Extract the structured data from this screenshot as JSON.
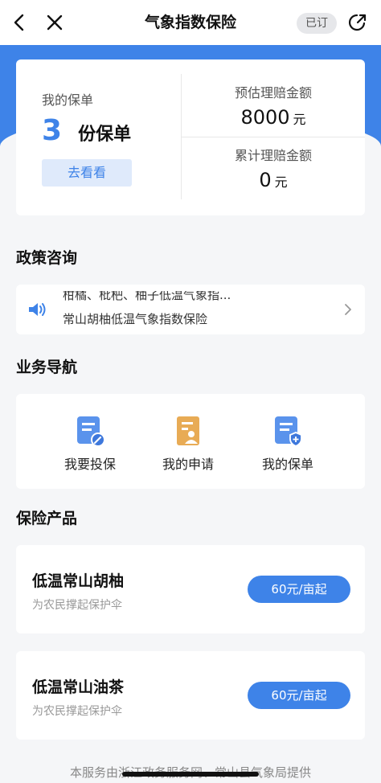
{
  "nav": {
    "title": "气象指数保险",
    "subscribed": "已订"
  },
  "summary": {
    "my_policy_label": "我的保单",
    "policy_count": "3",
    "policy_unit": "份保单",
    "view_button": "去看看",
    "estimated_label": "预估理赔金额",
    "estimated_value": "8000",
    "estimated_unit": "元",
    "cumulative_label": "累计理赔金额",
    "cumulative_value": "0",
    "cumulative_unit": "元"
  },
  "policy_section": {
    "title": "政策咨询",
    "ticker_line1": "柑橘、枇杷、柚子低温气象指...",
    "ticker_line2": "常山胡柚低温气象指数保险"
  },
  "service_section": {
    "title": "业务导航",
    "items": [
      {
        "label": "我要投保",
        "icon": "edit-document-icon",
        "color": "#4a86e8"
      },
      {
        "label": "我的申请",
        "icon": "applicant-document-icon",
        "color": "#e2a54b"
      },
      {
        "label": "我的保单",
        "icon": "shield-document-icon",
        "color": "#4a86e8"
      }
    ]
  },
  "products_section": {
    "title": "保险产品",
    "items": [
      {
        "name": "低温常山胡柚",
        "desc": "为农民撑起保护伞",
        "price": "60元/亩起"
      },
      {
        "name": "低温常山油茶",
        "desc": "为农民撑起保护伞",
        "price": "60元/亩起"
      }
    ]
  },
  "footer": {
    "text": "本服务由浙江政务服务网、常山县气象局提供"
  },
  "colors": {
    "accent": "#3e83e8",
    "background": "#f5f6f8"
  }
}
